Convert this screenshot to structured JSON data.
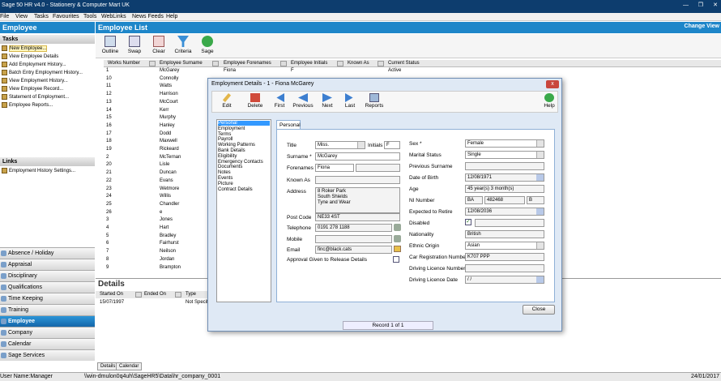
{
  "titlebar": {
    "title": "Sage 50 HR v4.0 - Stationery & Computer Mart UK"
  },
  "menu": [
    "File",
    "View",
    "Tasks",
    "Favourites",
    "Tools",
    "WebLinks",
    "News Feeds",
    "Help"
  ],
  "left": {
    "header": "Employee",
    "tasks_header": "Tasks",
    "tasks": [
      "New Employee...",
      "View Employee Details",
      "Add Employment History...",
      "Batch Entry Employment History...",
      "View Employment History...",
      "View Employee Record...",
      "Statement of Employment...",
      "Employee Reports..."
    ],
    "links_header": "Links",
    "links": [
      "Employment History Settings..."
    ],
    "nav": [
      "Absence / Holiday",
      "Appraisal",
      "Disciplinary",
      "Qualifications",
      "Time Keeping",
      "Training",
      "Employee",
      "Company",
      "Calendar",
      "Sage Services"
    ],
    "active_nav": "Employee"
  },
  "main": {
    "header": "Employee List",
    "change_view": "Change View",
    "toolbar": [
      "Outline",
      "Swap",
      "Clear",
      "Criteria",
      "Sage"
    ],
    "columns": [
      "Works Number",
      "Employee Surname",
      "Employee Forenames",
      "Employee Initials",
      "Known As",
      "Current Status"
    ],
    "rows": [
      {
        "n": "1",
        "s": "McGarey",
        "f": "Fiona",
        "i": "F",
        "a": "Active"
      },
      {
        "n": "10",
        "s": "Connolly",
        "f": "",
        "i": "",
        "a": ""
      },
      {
        "n": "11",
        "s": "Watts",
        "f": "",
        "i": "",
        "a": ""
      },
      {
        "n": "12",
        "s": "Harrison",
        "f": "",
        "i": "",
        "a": ""
      },
      {
        "n": "13",
        "s": "McCourt",
        "f": "",
        "i": "",
        "a": ""
      },
      {
        "n": "14",
        "s": "Kerr",
        "f": "",
        "i": "",
        "a": ""
      },
      {
        "n": "15",
        "s": "Murphy",
        "f": "",
        "i": "",
        "a": ""
      },
      {
        "n": "16",
        "s": "Hanley",
        "f": "",
        "i": "",
        "a": ""
      },
      {
        "n": "17",
        "s": "Dodd",
        "f": "",
        "i": "",
        "a": ""
      },
      {
        "n": "18",
        "s": "Maxwell",
        "f": "",
        "i": "",
        "a": ""
      },
      {
        "n": "19",
        "s": "Rickeard",
        "f": "",
        "i": "",
        "a": ""
      },
      {
        "n": "2",
        "s": "McTernan",
        "f": "",
        "i": "",
        "a": ""
      },
      {
        "n": "20",
        "s": "Lisle",
        "f": "",
        "i": "",
        "a": ""
      },
      {
        "n": "21",
        "s": "Duncan",
        "f": "",
        "i": "",
        "a": ""
      },
      {
        "n": "22",
        "s": "Evans",
        "f": "",
        "i": "",
        "a": ""
      },
      {
        "n": "23",
        "s": "Wetmore",
        "f": "",
        "i": "",
        "a": ""
      },
      {
        "n": "24",
        "s": "Willis",
        "f": "",
        "i": "",
        "a": ""
      },
      {
        "n": "25",
        "s": "Chandler",
        "f": "",
        "i": "",
        "a": ""
      },
      {
        "n": "26",
        "s": "e",
        "f": "",
        "i": "",
        "a": ""
      },
      {
        "n": "3",
        "s": "Jones",
        "f": "",
        "i": "",
        "a": ""
      },
      {
        "n": "4",
        "s": "Hart",
        "f": "",
        "i": "",
        "a": ""
      },
      {
        "n": "5",
        "s": "Bradley",
        "f": "",
        "i": "",
        "a": ""
      },
      {
        "n": "6",
        "s": "Fairhurst",
        "f": "",
        "i": "",
        "a": ""
      },
      {
        "n": "7",
        "s": "Neilson",
        "f": "",
        "i": "",
        "a": ""
      },
      {
        "n": "8",
        "s": "Jordan",
        "f": "",
        "i": "",
        "a": ""
      },
      {
        "n": "9",
        "s": "Brampton",
        "f": "",
        "i": "",
        "a": ""
      }
    ],
    "details": {
      "title": "Details",
      "columns": [
        "Started On",
        "Ended On",
        "Type"
      ],
      "row": {
        "started": "15/07/1997",
        "type": "Not Specif"
      },
      "tabs": [
        "Details",
        "Calendar"
      ]
    }
  },
  "status": {
    "user": "User Name:Manager",
    "path": "\\\\win-dmulon0q4uh\\SageHR5\\Data\\hr_company_0001",
    "date": "24/01/2017"
  },
  "dialog": {
    "title": "Employment Details - 1 - Fiona McGarey",
    "close": "x",
    "toolbar": [
      "Edit",
      "Delete",
      "First",
      "Previous",
      "Next",
      "Last",
      "Reports",
      "Help"
    ],
    "nav": [
      "Personal",
      "Employment",
      "Terms",
      "Payroll",
      "Working Patterns",
      "Bank Details",
      "Eligibility",
      "Emergency Contacts",
      "Documents",
      "Notes",
      "Events",
      "Picture",
      "Contract Details"
    ],
    "tab": "Personal",
    "labels": {
      "title": "Title",
      "initials": "Initials",
      "surname": "Surname *",
      "forenames": "Forenames *",
      "known_as": "Known As",
      "address": "Address",
      "postcode": "Post Code",
      "telephone": "Telephone",
      "mobile": "Mobile",
      "email": "Email",
      "approval": "Approval Given to Release Details",
      "sex": "Sex *",
      "marital": "Marital Status",
      "prev_surname": "Previous Surname",
      "dob": "Date of Birth",
      "age": "Age",
      "ni": "NI Number",
      "retire": "Expected to Retire",
      "disabled": "Disabled",
      "nationality": "Nationality",
      "ethnic": "Ethnic Origin",
      "car": "Car Registration Number",
      "dl_num": "Driving Licence Number",
      "dl_date": "Driving Licence Date"
    },
    "values": {
      "title": "Miss.",
      "initials": "F",
      "surname": "McGarey",
      "forenames": "Fiona",
      "known_as": "",
      "address": [
        "8 Roker Park",
        "South Shields",
        "Tyne and Wear"
      ],
      "postcode": "NE33 4ST",
      "telephone": "0191 278 1188",
      "mobile": "",
      "email": "finc@black.cats",
      "sex": "Female",
      "marital": "Single",
      "prev_surname": "",
      "dob": "12/08/1971",
      "age": "45 year(s) 3 month(s)",
      "ni1": "BA",
      "ni2": "482468",
      "ni3": "B",
      "retire": "12/08/2036",
      "nationality": "British",
      "ethnic": "Asian",
      "car": "K707 PPP",
      "dl_num": "",
      "dl_date": "/ /"
    },
    "close_button": "Close",
    "record": "Record 1 of 1"
  }
}
